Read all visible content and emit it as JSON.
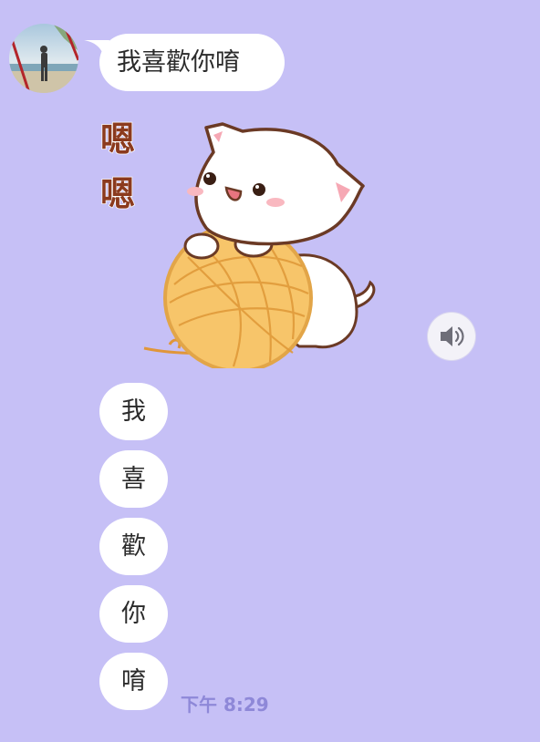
{
  "chat": {
    "messages": [
      {
        "type": "text",
        "text": "我喜歡你唷"
      },
      {
        "type": "sticker",
        "sticker_text": "嗯嗯"
      }
    ],
    "char_bubbles": [
      "我",
      "喜",
      "歡",
      "你",
      "唷"
    ],
    "timestamp": "下午 8:29"
  },
  "icons": {
    "avatar": "profile-photo",
    "sound": "speaker-icon"
  },
  "colors": {
    "background": "#c6c0f6",
    "bubble": "#ffffff",
    "timestamp": "#8e88d8",
    "sticker_text": "#8b3a1e"
  }
}
